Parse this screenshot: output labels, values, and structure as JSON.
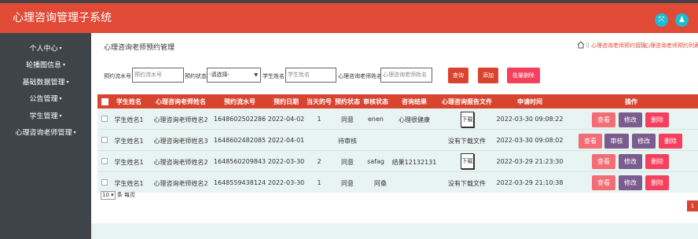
{
  "app": {
    "title": "心理咨询管理子系统"
  },
  "header_icons": [
    "expand-icon",
    "user-icon"
  ],
  "sidebar": {
    "items": [
      {
        "label": "个人中心"
      },
      {
        "label": "轮播图信息"
      },
      {
        "label": "基础数据管理"
      },
      {
        "label": "公告管理"
      },
      {
        "label": "学生管理"
      },
      {
        "label": "心理咨询老师管理"
      }
    ]
  },
  "page": {
    "title": "心理咨询老师预约管理",
    "breadcrumb": [
      "心理咨询老师预约管理",
      "心理咨询老师预约列表"
    ],
    "breadcrumb_sep": "||"
  },
  "filters": {
    "serial_label": "预约流水号",
    "serial_placeholder": "预约流水号",
    "status_label": "预约状态",
    "status_value": "-请选择-",
    "student_label": "学生姓名",
    "student_placeholder": "学生姓名",
    "teacher_label": "心理咨询老师姓名",
    "teacher_placeholder": "心理咨询老师姓名",
    "search_btn": "查询",
    "add_btn": "添加",
    "batch_delete_btn": "批量删除"
  },
  "table": {
    "columns": [
      "学生姓名",
      "心理咨询老师姓名",
      "预约流水号",
      "预约日期",
      "当天的号",
      "预约状态",
      "审核状态",
      "咨询结果",
      "心理咨询报告文件",
      "申请时间",
      "操作"
    ],
    "rows": [
      {
        "student": "学生姓名1",
        "teacher": "心理咨询老师姓名2",
        "serial": "1648602502286",
        "date": "2022-04-02",
        "num": "1",
        "status": "同意",
        "audit": "enen",
        "result": "心理很健康",
        "file": "下载",
        "time": "2022-03-30 09:08:22"
      },
      {
        "student": "学生姓名1",
        "teacher": "心理咨询老师姓名3",
        "serial": "1648602482085",
        "date": "2022-04-01",
        "num": "",
        "status": "待审核",
        "audit": "",
        "result": "",
        "file": "没有下载文件",
        "time": "2022-03-30 09:08:02"
      },
      {
        "student": "学生姓名1",
        "teacher": "心理咨询老师姓名2",
        "serial": "1648560209843",
        "date": "2022-03-30",
        "num": "2",
        "status": "同意",
        "audit": "safag",
        "result": "结果12132131",
        "file": "下载",
        "time": "2022-03-29 21:23:30"
      },
      {
        "student": "学生姓名1",
        "teacher": "心理咨询老师姓名2",
        "serial": "1648559438124",
        "date": "2022-03-30",
        "num": "1",
        "status": "同意",
        "audit": "阿桑",
        "result": "",
        "file": "没有下载文件",
        "time": "2022-03-29 21:10:38"
      }
    ],
    "actions": {
      "view": "查看",
      "audit": "审核",
      "edit": "修改",
      "delete": "删除"
    }
  },
  "pagination": {
    "page_size": "10",
    "per_page_label": "条 每页",
    "current_page": "1"
  },
  "colors": {
    "header": "#e04a37",
    "sidebar": "#3f4449",
    "table_head": "#d9442f",
    "row_bg": "#e8f4f1",
    "icon_accent": "#1cbcd3"
  }
}
